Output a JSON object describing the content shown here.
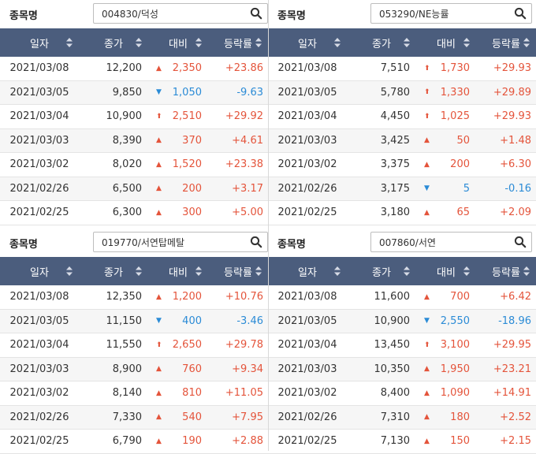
{
  "colors": {
    "header_bg": "#4b5d7d",
    "up": "#e4543b",
    "down": "#2b8bd6"
  },
  "icons": {
    "search": "magnifier-icon",
    "sort": "sort-arrows-icon",
    "rise": "triangle-up-icon",
    "fall": "triangle-down-icon",
    "limit": "arrow-up-icon"
  },
  "panels": [
    {
      "label": "종목명",
      "search_value": "004830/덕성",
      "headers": [
        "일자",
        "종가",
        "대비",
        "등락률"
      ],
      "rows": [
        {
          "date": "2021/03/08",
          "close": "12,200",
          "dir": "up",
          "arrow": "▲",
          "change": "2,350",
          "rate": "+23.86"
        },
        {
          "date": "2021/03/05",
          "close": "9,850",
          "dir": "down",
          "arrow": "▼",
          "change": "1,050",
          "rate": "-9.63"
        },
        {
          "date": "2021/03/04",
          "close": "10,900",
          "dir": "up",
          "arrow": "⬆",
          "change": "2,510",
          "rate": "+29.92"
        },
        {
          "date": "2021/03/03",
          "close": "8,390",
          "dir": "up",
          "arrow": "▲",
          "change": "370",
          "rate": "+4.61"
        },
        {
          "date": "2021/03/02",
          "close": "8,020",
          "dir": "up",
          "arrow": "▲",
          "change": "1,520",
          "rate": "+23.38"
        },
        {
          "date": "2021/02/26",
          "close": "6,500",
          "dir": "up",
          "arrow": "▲",
          "change": "200",
          "rate": "+3.17"
        },
        {
          "date": "2021/02/25",
          "close": "6,300",
          "dir": "up",
          "arrow": "▲",
          "change": "300",
          "rate": "+5.00"
        }
      ]
    },
    {
      "label": "종목명",
      "search_value": "053290/NE능률",
      "headers": [
        "일자",
        "종가",
        "대비",
        "등락률"
      ],
      "rows": [
        {
          "date": "2021/03/08",
          "close": "7,510",
          "dir": "up",
          "arrow": "⬆",
          "change": "1,730",
          "rate": "+29.93"
        },
        {
          "date": "2021/03/05",
          "close": "5,780",
          "dir": "up",
          "arrow": "⬆",
          "change": "1,330",
          "rate": "+29.89"
        },
        {
          "date": "2021/03/04",
          "close": "4,450",
          "dir": "up",
          "arrow": "⬆",
          "change": "1,025",
          "rate": "+29.93"
        },
        {
          "date": "2021/03/03",
          "close": "3,425",
          "dir": "up",
          "arrow": "▲",
          "change": "50",
          "rate": "+1.48"
        },
        {
          "date": "2021/03/02",
          "close": "3,375",
          "dir": "up",
          "arrow": "▲",
          "change": "200",
          "rate": "+6.30"
        },
        {
          "date": "2021/02/26",
          "close": "3,175",
          "dir": "down",
          "arrow": "▼",
          "change": "5",
          "rate": "-0.16"
        },
        {
          "date": "2021/02/25",
          "close": "3,180",
          "dir": "up",
          "arrow": "▲",
          "change": "65",
          "rate": "+2.09"
        }
      ]
    },
    {
      "label": "종목명",
      "search_value": "019770/서연탑메탈",
      "headers": [
        "일자",
        "종가",
        "대비",
        "등락률"
      ],
      "rows": [
        {
          "date": "2021/03/08",
          "close": "12,350",
          "dir": "up",
          "arrow": "▲",
          "change": "1,200",
          "rate": "+10.76"
        },
        {
          "date": "2021/03/05",
          "close": "11,150",
          "dir": "down",
          "arrow": "▼",
          "change": "400",
          "rate": "-3.46"
        },
        {
          "date": "2021/03/04",
          "close": "11,550",
          "dir": "up",
          "arrow": "⬆",
          "change": "2,650",
          "rate": "+29.78"
        },
        {
          "date": "2021/03/03",
          "close": "8,900",
          "dir": "up",
          "arrow": "▲",
          "change": "760",
          "rate": "+9.34"
        },
        {
          "date": "2021/03/02",
          "close": "8,140",
          "dir": "up",
          "arrow": "▲",
          "change": "810",
          "rate": "+11.05"
        },
        {
          "date": "2021/02/26",
          "close": "7,330",
          "dir": "up",
          "arrow": "▲",
          "change": "540",
          "rate": "+7.95"
        },
        {
          "date": "2021/02/25",
          "close": "6,790",
          "dir": "up",
          "arrow": "▲",
          "change": "190",
          "rate": "+2.88"
        }
      ]
    },
    {
      "label": "종목명",
      "search_value": "007860/서연",
      "headers": [
        "일자",
        "종가",
        "대비",
        "등락률"
      ],
      "rows": [
        {
          "date": "2021/03/08",
          "close": "11,600",
          "dir": "up",
          "arrow": "▲",
          "change": "700",
          "rate": "+6.42"
        },
        {
          "date": "2021/03/05",
          "close": "10,900",
          "dir": "down",
          "arrow": "▼",
          "change": "2,550",
          "rate": "-18.96"
        },
        {
          "date": "2021/03/04",
          "close": "13,450",
          "dir": "up",
          "arrow": "⬆",
          "change": "3,100",
          "rate": "+29.95"
        },
        {
          "date": "2021/03/03",
          "close": "10,350",
          "dir": "up",
          "arrow": "▲",
          "change": "1,950",
          "rate": "+23.21"
        },
        {
          "date": "2021/03/02",
          "close": "8,400",
          "dir": "up",
          "arrow": "▲",
          "change": "1,090",
          "rate": "+14.91"
        },
        {
          "date": "2021/02/26",
          "close": "7,310",
          "dir": "up",
          "arrow": "▲",
          "change": "180",
          "rate": "+2.52"
        },
        {
          "date": "2021/02/25",
          "close": "7,130",
          "dir": "up",
          "arrow": "▲",
          "change": "150",
          "rate": "+2.15"
        }
      ]
    }
  ]
}
